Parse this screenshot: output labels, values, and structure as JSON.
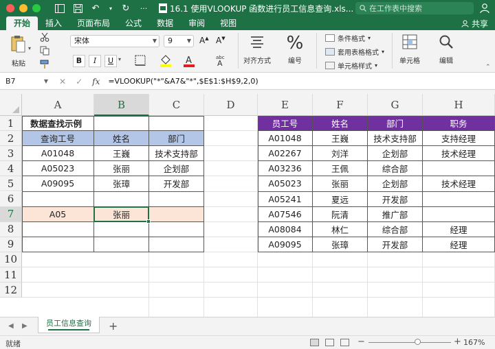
{
  "window": {
    "title": "16.1 使用VLOOKUP 函数进行员工信息查询.xls...",
    "search_placeholder": "在工作表中搜索"
  },
  "ribbon": {
    "tabs": [
      "开始",
      "插入",
      "页面布局",
      "公式",
      "数据",
      "审阅",
      "视图"
    ],
    "share_label": "共享",
    "paste_label": "粘贴",
    "font_name": "宋体",
    "font_size": "9",
    "bold": "B",
    "italic": "I",
    "underline": "U",
    "align_label": "对齐方式",
    "number_label": "编号",
    "percent_glyph": "%",
    "conditional_format": "条件格式",
    "table_format": "套用表格格式",
    "cell_style": "单元格样式",
    "cells_label": "单元格",
    "edit_label": "编辑"
  },
  "formula_bar": {
    "name_box": "B7",
    "fx": "fx",
    "formula": "=VLOOKUP(\"*\"&A7&\"*\",$E$1:$H$9,2,0)"
  },
  "columns": [
    "A",
    "B",
    "C",
    "D",
    "E",
    "F",
    "G",
    "H"
  ],
  "rows": [
    "1",
    "2",
    "3",
    "4",
    "5",
    "6",
    "7",
    "8",
    "9",
    "10",
    "11",
    "12"
  ],
  "lookup_table": {
    "title": "数据查找示例",
    "headers": [
      "查询工号",
      "姓名",
      "部门"
    ],
    "rows": [
      [
        "A01048",
        "王巍",
        "技术支持部"
      ],
      [
        "A05023",
        "张丽",
        "企划部"
      ],
      [
        "A09095",
        "张璋",
        "开发部"
      ]
    ],
    "query_id": "A05",
    "query_result": "张丽"
  },
  "employee_table": {
    "headers": [
      "员工号",
      "姓名",
      "部门",
      "职务"
    ],
    "rows": [
      [
        "A01048",
        "王巍",
        "技术支持部",
        "支持经理"
      ],
      [
        "A02267",
        "刘洋",
        "企划部",
        "技术经理"
      ],
      [
        "A03236",
        "王佩",
        "综合部",
        ""
      ],
      [
        "A05023",
        "张丽",
        "企划部",
        "技术经理"
      ],
      [
        "A05241",
        "夏远",
        "开发部",
        ""
      ],
      [
        "A07546",
        "阮清",
        "推广部",
        ""
      ],
      [
        "A08084",
        "林仁",
        "综合部",
        "经理"
      ],
      [
        "A09095",
        "张璋",
        "开发部",
        "经理"
      ]
    ]
  },
  "sheet_tabs": [
    "员工信息查询"
  ],
  "status": {
    "text": "就绪",
    "zoom": "167%"
  },
  "colors": {
    "accent": "#1e7145",
    "header_blue": "#b4c6e7",
    "header_purple": "#7030a0",
    "query_orange": "#fce4d6"
  }
}
